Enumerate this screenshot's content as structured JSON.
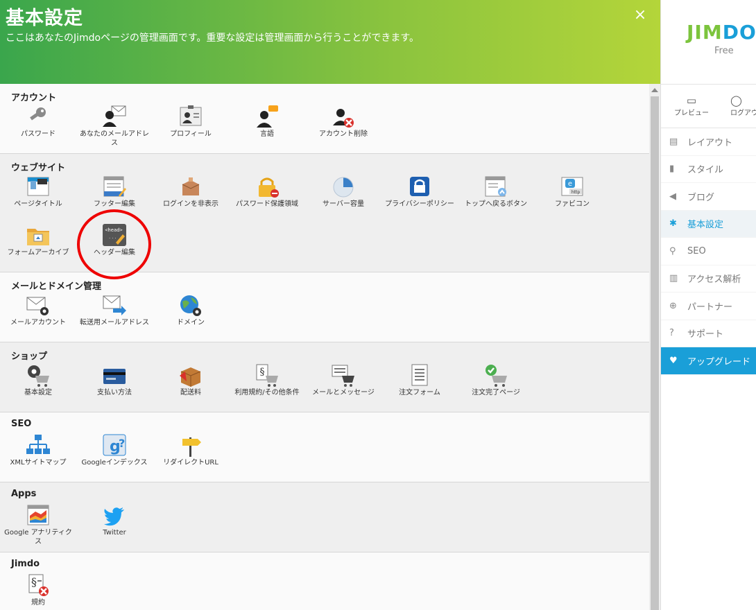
{
  "header": {
    "title": "基本設定",
    "subtitle": "ここはあなたのJimdoページの管理画面です。重要な設定は管理画面から行うことができます。",
    "close_symbol": "×"
  },
  "sections": [
    {
      "title": "アカウント",
      "items": [
        {
          "label": "パスワード",
          "icon": "key-icon"
        },
        {
          "label": "あなたのメールアドレス",
          "icon": "user-mail-icon"
        },
        {
          "label": "プロフィール",
          "icon": "profile-card-icon"
        },
        {
          "label": "言語",
          "icon": "user-speech-icon"
        },
        {
          "label": "アカウント削除",
          "icon": "user-delete-icon"
        }
      ]
    },
    {
      "title": "ウェブサイト",
      "items": [
        {
          "label": "ページタイトル",
          "icon": "page-title-icon"
        },
        {
          "label": "フッター編集",
          "icon": "footer-edit-icon"
        },
        {
          "label": "ログインを非表示",
          "icon": "hide-login-icon"
        },
        {
          "label": "パスワード保護領域",
          "icon": "password-lock-icon"
        },
        {
          "label": "サーバー容量",
          "icon": "pie-chart-icon"
        },
        {
          "label": "プライバシーポリシー",
          "icon": "privacy-lock-icon"
        },
        {
          "label": "トップへ戻るボタン",
          "icon": "back-to-top-icon"
        },
        {
          "label": "ファビコン",
          "icon": "favicon-icon"
        },
        {
          "label": "フォームアーカイブ",
          "icon": "folder-icon"
        },
        {
          "label": "ヘッダー編集",
          "icon": "head-edit-icon",
          "icon_text": "<head>"
        }
      ]
    },
    {
      "title": "メールとドメイン管理",
      "items": [
        {
          "label": "メールアカウント",
          "icon": "mail-gear-icon"
        },
        {
          "label": "転送用メールアドレス",
          "icon": "mail-forward-icon"
        },
        {
          "label": "ドメイン",
          "icon": "globe-gear-icon"
        }
      ]
    },
    {
      "title": "ショップ",
      "items": [
        {
          "label": "基本設定",
          "icon": "cart-gear-icon"
        },
        {
          "label": "支払い方法",
          "icon": "credit-card-icon"
        },
        {
          "label": "配送料",
          "icon": "package-icon"
        },
        {
          "label": "利用規約/その他条件",
          "icon": "cart-terms-icon"
        },
        {
          "label": "メールとメッセージ",
          "icon": "cart-message-icon"
        },
        {
          "label": "注文フォーム",
          "icon": "order-form-icon"
        },
        {
          "label": "注文完了ページ",
          "icon": "cart-check-icon"
        }
      ]
    },
    {
      "title": "SEO",
      "items": [
        {
          "label": "XMLサイトマップ",
          "icon": "sitemap-icon"
        },
        {
          "label": "Googleインデックス",
          "icon": "google-index-icon"
        },
        {
          "label": "リダイレクトURL",
          "icon": "signpost-icon"
        }
      ]
    },
    {
      "title": "Apps",
      "items": [
        {
          "label": "Google アナリティクス",
          "icon": "analytics-icon"
        },
        {
          "label": "Twitter",
          "icon": "twitter-icon"
        }
      ]
    },
    {
      "title": "Jimdo",
      "items": [
        {
          "label": "規約",
          "icon": "terms-delete-icon"
        }
      ]
    }
  ],
  "sidebar": {
    "logo": {
      "part1": "JIM",
      "part2": "DO"
    },
    "plan": "Free",
    "preview_label": "プレビュー",
    "logout_label": "ログアウト",
    "nav": [
      {
        "label": "レイアウト",
        "icon": "layout-icon"
      },
      {
        "label": "スタイル",
        "icon": "paint-roller-icon"
      },
      {
        "label": "ブログ",
        "icon": "megaphone-icon"
      },
      {
        "label": "基本設定",
        "icon": "gear-icon",
        "active": true
      },
      {
        "label": "SEO",
        "icon": "search-icon"
      },
      {
        "label": "アクセス解析",
        "icon": "bar-chart-icon"
      },
      {
        "label": "パートナー",
        "icon": "plus-circle-icon"
      },
      {
        "label": "サポート",
        "icon": "question-icon"
      },
      {
        "label": "アップグレード",
        "icon": "heart-icon"
      }
    ]
  },
  "colors": {
    "header_start": "#3aa64c",
    "header_end": "#b4d53a",
    "accent": "#1a9fd8",
    "highlight_circle": "#e00000"
  }
}
